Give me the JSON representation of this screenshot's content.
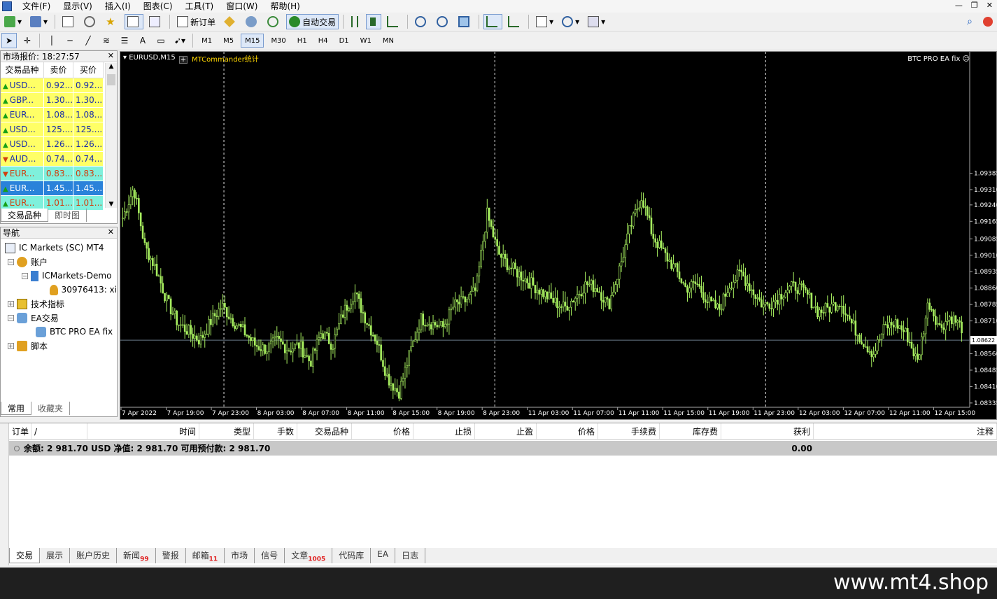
{
  "menubar": {
    "items": [
      "文件(F)",
      "显示(V)",
      "插入(I)",
      "图表(C)",
      "工具(T)",
      "窗口(W)",
      "帮助(H)"
    ]
  },
  "toolbar": {
    "new_order": "新订单",
    "auto_trading": "自动交易",
    "timeframes": [
      "M1",
      "M5",
      "M15",
      "M30",
      "H1",
      "H4",
      "D1",
      "W1",
      "MN"
    ],
    "active_timeframe": "M15"
  },
  "market_watch": {
    "title": "市场报价: 18:27:57",
    "headers": [
      "交易品种",
      "卖价",
      "买价"
    ],
    "rows": [
      {
        "symbol": "USD...",
        "bid": "0.92...",
        "ask": "0.92...",
        "dir": "up",
        "style": "yellow"
      },
      {
        "symbol": "GBP...",
        "bid": "1.30...",
        "ask": "1.30...",
        "dir": "up",
        "style": "yellow"
      },
      {
        "symbol": "EUR...",
        "bid": "1.08...",
        "ask": "1.08...",
        "dir": "up",
        "style": "yellow"
      },
      {
        "symbol": "USD...",
        "bid": "125....",
        "ask": "125....",
        "dir": "up",
        "style": "yellow"
      },
      {
        "symbol": "USD...",
        "bid": "1.26...",
        "ask": "1.26...",
        "dir": "up",
        "style": "yellow"
      },
      {
        "symbol": "AUD...",
        "bid": "0.74...",
        "ask": "0.74...",
        "dir": "down",
        "style": "yellow"
      },
      {
        "symbol": "EUR...",
        "bid": "0.83...",
        "ask": "0.83...",
        "dir": "down",
        "style": "cyan"
      },
      {
        "symbol": "EUR...",
        "bid": "1.45...",
        "ask": "1.45...",
        "dir": "up",
        "style": "blue"
      },
      {
        "symbol": "EUR...",
        "bid": "1.01...",
        "ask": "1.01...",
        "dir": "up",
        "style": "cyan"
      }
    ],
    "tabs": [
      "交易品种",
      "即时图"
    ]
  },
  "navigator": {
    "title": "导航",
    "root": "IC Markets (SC) MT4",
    "accounts": "账户",
    "account_server": "ICMarkets-Demo",
    "account_id": "30976413: xi",
    "indicators": "技术指标",
    "experts": "EA交易",
    "expert_item": "BTC PRO EA fix",
    "scripts": "脚本",
    "tabs": [
      "常用",
      "收藏夹"
    ]
  },
  "chart": {
    "symbol": "EURUSD,M15",
    "ea_left": "MTCommander统计",
    "ea_right": "BTC PRO EA fix",
    "current_price": "1.08622",
    "colors": {
      "background": "#000000",
      "candle": "#a8f060",
      "grid": "#ffffff",
      "price_line": "#6a7a8a"
    }
  },
  "chart_data": {
    "type": "bar",
    "title": "",
    "ylim": [
      1.08325,
      1.09895
    ],
    "y_ticks": [
      1.09385,
      1.0931,
      1.0924,
      1.09165,
      1.09085,
      1.0901,
      1.08935,
      1.0886,
      1.08785,
      1.0871,
      1.08622,
      1.0856,
      1.08485,
      1.0841,
      1.08335
    ],
    "x_labels": [
      "7 Apr 2022",
      "7 Apr 19:00",
      "7 Apr 23:00",
      "8 Apr 03:00",
      "8 Apr 07:00",
      "8 Apr 11:00",
      "8 Apr 15:00",
      "8 Apr 19:00",
      "8 Apr 23:00",
      "11 Apr 03:00",
      "11 Apr 07:00",
      "11 Apr 11:00",
      "11 Apr 15:00",
      "11 Apr 19:00",
      "11 Apr 23:00",
      "12 Apr 03:00",
      "12 Apr 07:00",
      "12 Apr 11:00",
      "12 Apr 15:00"
    ],
    "series": [
      {
        "values": [
          1.0918,
          1.0932,
          1.0905,
          1.0895,
          1.088,
          1.087,
          1.0866,
          1.0862,
          1.0871,
          1.0878,
          1.0871,
          1.0866,
          1.086,
          1.0858,
          1.0862,
          1.0858,
          1.086,
          1.0852,
          1.0866,
          1.086,
          1.0875,
          1.0884,
          1.0872,
          1.0862,
          1.0845,
          1.0838,
          1.0856,
          1.0872,
          1.087,
          1.0868,
          1.0878,
          1.088,
          1.0885,
          1.092,
          1.0902,
          1.0896,
          1.0892,
          1.0888,
          1.0884,
          1.088,
          1.0877,
          1.0882,
          1.0888,
          1.0886,
          1.0878,
          1.0895,
          1.0914,
          1.0928,
          1.091,
          1.0902,
          1.0895,
          1.0886,
          1.0888,
          1.088,
          1.0876,
          1.0888,
          1.0893,
          1.0885,
          1.0878,
          1.088,
          1.0885,
          1.0887,
          1.0883,
          1.0875,
          1.0877,
          1.088,
          1.087,
          1.0862,
          1.0856,
          1.0868,
          1.087,
          1.0865,
          1.0852,
          1.088,
          1.0868,
          1.0873,
          1.0868
        ]
      }
    ],
    "grid": false,
    "vertical_separators": [
      "7 Apr 23:00",
      "8 Apr 23:00",
      "11 Apr 23:00"
    ]
  },
  "terminal": {
    "headers": [
      "订单",
      "/",
      "时间",
      "类型",
      "手数",
      "交易品种",
      "价格",
      "止损",
      "止盈",
      "价格",
      "手续费",
      "库存费",
      "获利",
      "注释"
    ],
    "balance_text": "余额: 2 981.70 USD  净值: 2 981.70  可用预付款: 2 981.70",
    "profit": "0.00",
    "tabs": [
      {
        "label": "交易",
        "badge": ""
      },
      {
        "label": "展示",
        "badge": ""
      },
      {
        "label": "账户历史",
        "badge": ""
      },
      {
        "label": "新闻",
        "badge": "99"
      },
      {
        "label": "警报",
        "badge": ""
      },
      {
        "label": "邮箱",
        "badge": "11"
      },
      {
        "label": "市场",
        "badge": ""
      },
      {
        "label": "信号",
        "badge": ""
      },
      {
        "label": "文章",
        "badge": "1005"
      },
      {
        "label": "代码库",
        "badge": ""
      },
      {
        "label": "EA",
        "badge": ""
      },
      {
        "label": "日志",
        "badge": ""
      }
    ]
  },
  "footer": {
    "watermark": "www.mt4.shop"
  }
}
